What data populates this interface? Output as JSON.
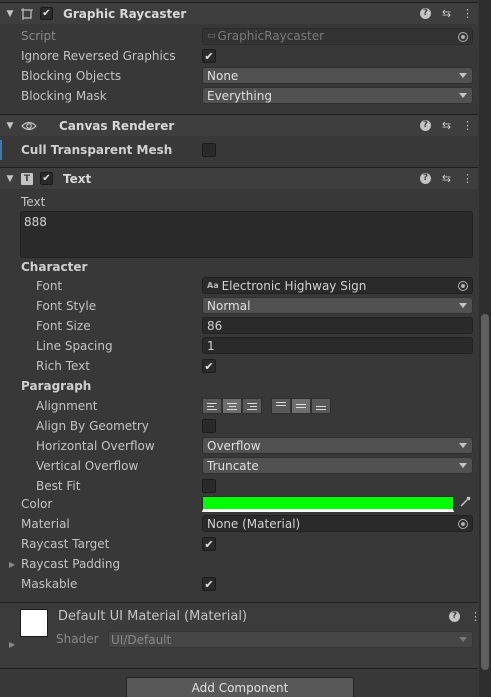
{
  "graphic_raycaster": {
    "title": "Graphic Raycaster",
    "script_label": "Script",
    "script_value": "GraphicRaycaster",
    "ignore_reversed_label": "Ignore Reversed Graphics",
    "blocking_objects_label": "Blocking Objects",
    "blocking_objects_value": "None",
    "blocking_mask_label": "Blocking Mask",
    "blocking_mask_value": "Everything"
  },
  "canvas_renderer": {
    "title": "Canvas Renderer",
    "cull_label": "Cull Transparent Mesh"
  },
  "text_component": {
    "title": "Text",
    "icon_letter": "T",
    "text_label": "Text",
    "text_value": "888",
    "character_header": "Character",
    "font_label": "Font",
    "font_icon": "Aa",
    "font_value": "Electronic Highway Sign",
    "font_style_label": "Font Style",
    "font_style_value": "Normal",
    "font_size_label": "Font Size",
    "font_size_value": "86",
    "line_spacing_label": "Line Spacing",
    "line_spacing_value": "1",
    "rich_text_label": "Rich Text",
    "paragraph_header": "Paragraph",
    "alignment_label": "Alignment",
    "align_by_geometry_label": "Align By Geometry",
    "horizontal_overflow_label": "Horizontal Overflow",
    "horizontal_overflow_value": "Overflow",
    "vertical_overflow_label": "Vertical Overflow",
    "vertical_overflow_value": "Truncate",
    "best_fit_label": "Best Fit",
    "color_label": "Color",
    "color_value": "#00ff00",
    "material_label": "Material",
    "material_value": "None (Material)",
    "raycast_target_label": "Raycast Target",
    "raycast_padding_label": "Raycast Padding",
    "maskable_label": "Maskable"
  },
  "material_section": {
    "title": "Default UI Material (Material)",
    "shader_label": "Shader",
    "shader_value": "UI/Default"
  },
  "add_component_label": "Add Component",
  "glyphs": {
    "check": "✔",
    "help": "?",
    "menu": "⋮",
    "fold_open": "▼",
    "fold_closed": "▶",
    "presets": "⇆"
  }
}
